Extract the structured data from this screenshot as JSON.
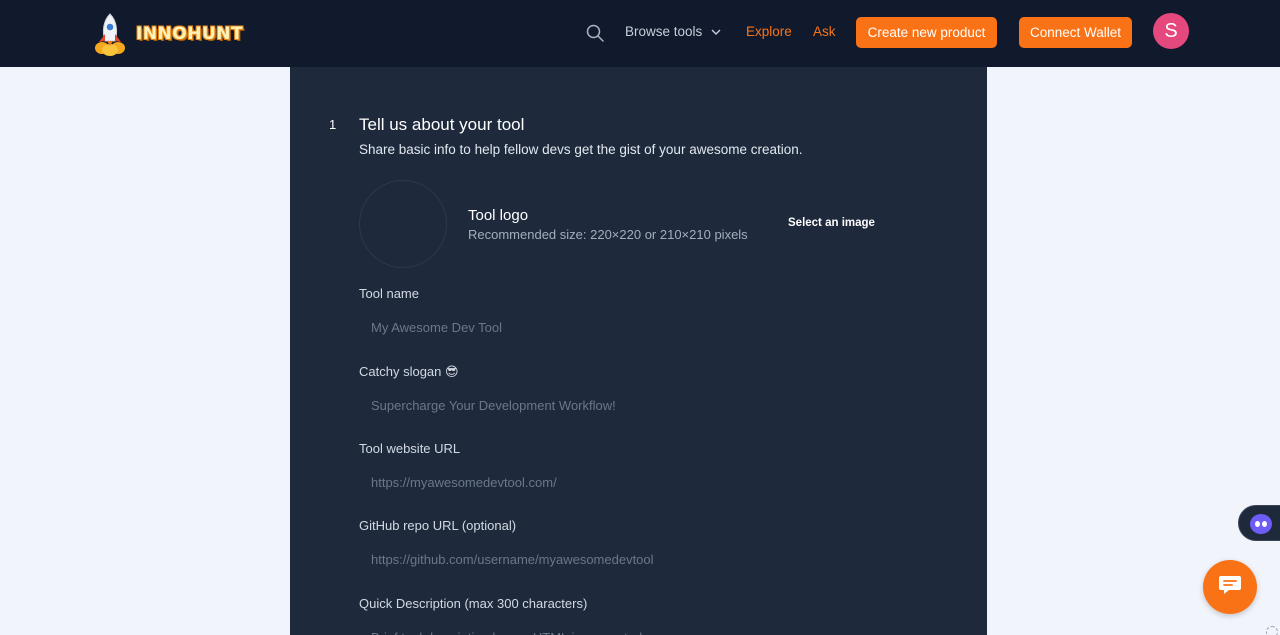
{
  "header": {
    "brand": "INNOHUNT",
    "nav": {
      "browse": "Browse tools",
      "explore": "Explore",
      "ask": "Ask"
    },
    "create_button": "Create new product",
    "wallet_button": "Connect Wallet",
    "avatar_initial": "S"
  },
  "form": {
    "step_number": "1",
    "title": "Tell us about your tool",
    "subtitle": "Share basic info to help fellow devs get the gist of your awesome creation.",
    "logo": {
      "label": "Tool logo",
      "hint": "Recommended size: 220×220 or 210×210 pixels",
      "select_label": "Select an image"
    },
    "fields": {
      "name": {
        "label": "Tool name",
        "placeholder": "My Awesome Dev Tool"
      },
      "slogan": {
        "label": "Catchy slogan 😎",
        "placeholder": "Supercharge Your Development Workflow!"
      },
      "website": {
        "label": "Tool website URL",
        "placeholder": "https://myawesomedevtool.com/"
      },
      "github": {
        "label": "GitHub repo URL (optional)",
        "placeholder": "https://github.com/username/myawesomedevtool"
      },
      "description": {
        "label": "Quick Description (max 300 characters)",
        "placeholder": "Brief tool description here... HTML is supported"
      }
    }
  },
  "colors": {
    "header_bg": "#111a2c",
    "panel_bg": "#1e293b",
    "accent": "#f97316",
    "avatar": "#e5487d",
    "page_bg": "#f1f5fb"
  },
  "icons": {
    "search": "search-icon",
    "browse_dropdown": "chevron-down-icon",
    "chat": "chat-bubble-icon",
    "bot": "bot-icon"
  }
}
